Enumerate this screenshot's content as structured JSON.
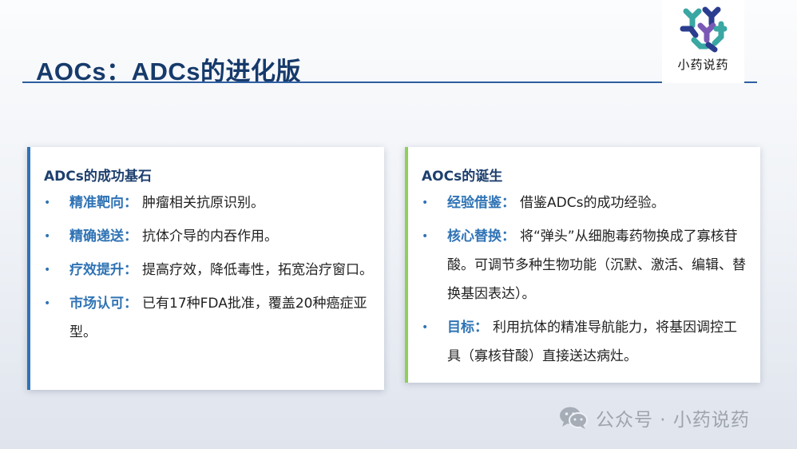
{
  "slide": {
    "title": "AOCs：ADCs的进化版"
  },
  "logo": {
    "text": "小药说药",
    "colors": [
      "#2a3d8f",
      "#3aa7a3",
      "#7a59b5"
    ]
  },
  "left_card": {
    "title": "ADCs的成功基石",
    "accent": "#2f73b5",
    "items": [
      {
        "key": "精准靶向：",
        "text": "肿瘤相关抗原识别。"
      },
      {
        "key": "精确递送：",
        "text": "抗体介导的内吞作用。"
      },
      {
        "key": "疗效提升：",
        "text": "提高疗效，降低毒性，拓宽治疗窗口。"
      },
      {
        "key": "市场认可：",
        "text": "已有17种FDA批准，覆盖20种癌症亚型。"
      }
    ]
  },
  "right_card": {
    "title": "AOCs的诞生",
    "accent": "#8fcf5a",
    "items": [
      {
        "key": "经验借鉴：",
        "text": "借鉴ADCs的成功经验。"
      },
      {
        "key": "核心替换：",
        "text": "将“弹头”从细胞毒药物换成了寡核苷酸。可调节多种生物功能（沉默、激活、编辑、替换基因表达）。"
      },
      {
        "key": "目标：",
        "text": "利用抗体的精准导航能力，将基因调控工具（寡核苷酸）直接送达病灶。"
      }
    ]
  },
  "bullet": "•",
  "watermark": {
    "icon": "wechat-icon",
    "text": "公众号 · 小药说药"
  }
}
